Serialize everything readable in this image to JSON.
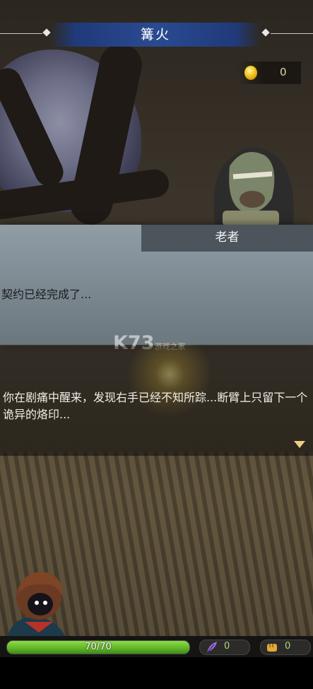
{
  "header": {
    "title": "篝火"
  },
  "currency": {
    "coins": "0"
  },
  "dialog": {
    "speaker": "老者",
    "speech": "契约已经完成了...",
    "narration": "你在剧痛中醒来，发现右手已经不知所踪...断臂上只留下一个诡异的烙印..."
  },
  "watermark": {
    "logo": "K73",
    "site": "游戏之家"
  },
  "hud": {
    "hp_text": "70/70",
    "hp_fraction": 1.0,
    "feather_count": "0",
    "fist_count": "0"
  },
  "colors": {
    "title_ribbon": "#2a4a91",
    "hp_bar": "#5fb326",
    "coin": "#f2c21b"
  },
  "icons": [
    "coin-icon",
    "feather-icon",
    "fist-icon",
    "next-arrow-icon"
  ]
}
